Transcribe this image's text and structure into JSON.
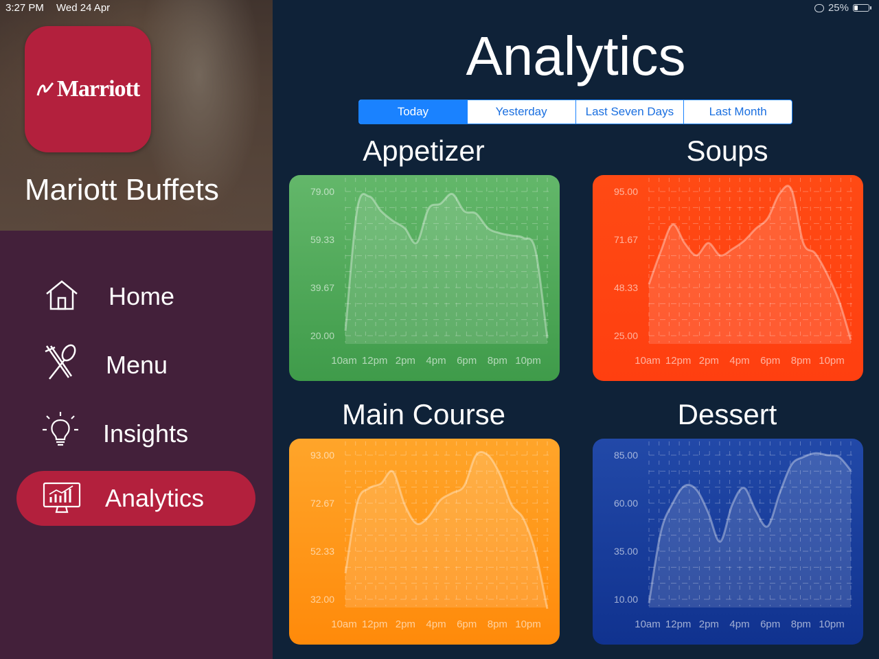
{
  "status": {
    "time": "3:27 PM",
    "date": "Wed 24 Apr",
    "battery": "25%",
    "battery_level": 0.25
  },
  "sidebar": {
    "logo_text": "Marriott",
    "app_title": "Mariott Buffets",
    "items": [
      {
        "label": "Home",
        "icon": "home-icon",
        "active": false
      },
      {
        "label": "Menu",
        "icon": "fork-spoon-icon",
        "active": false
      },
      {
        "label": "Insights",
        "icon": "lightbulb-icon",
        "active": false
      },
      {
        "label": "Analytics",
        "icon": "analytics-monitor-icon",
        "active": true
      }
    ]
  },
  "main": {
    "title": "Analytics",
    "tabs": [
      {
        "label": "Today",
        "active": true
      },
      {
        "label": "Yesterday",
        "active": false
      },
      {
        "label": "Last Seven Days",
        "active": false
      },
      {
        "label": "Last Month",
        "active": false
      }
    ]
  },
  "colors": {
    "accent": "#b3203d",
    "sidebar": "#43203a",
    "main_bg": "#0f2238",
    "segment_blue": "#1a82ff"
  },
  "chart_data": [
    {
      "type": "area",
      "title": "Appetizer",
      "color_top": "#63b76a",
      "color_bottom": "#3f9b4a",
      "x": [
        "10am",
        "12pm",
        "2pm",
        "4pm",
        "6pm",
        "8pm",
        "10pm"
      ],
      "y_ticks": [
        "79.00",
        "59.33",
        "39.67",
        "20.00"
      ],
      "ylim": [
        20,
        79
      ],
      "values": [
        22,
        72,
        77,
        71,
        67,
        64,
        58,
        72,
        74,
        78,
        71,
        70,
        64,
        62,
        61,
        60,
        55,
        19
      ]
    },
    {
      "type": "area",
      "title": "Soups",
      "color_top": "#ff4a14",
      "color_bottom": "#ff3f10",
      "x": [
        "10am",
        "12pm",
        "2pm",
        "4pm",
        "6pm",
        "8pm",
        "10pm"
      ],
      "y_ticks": [
        "95.00",
        "71.67",
        "48.33",
        "25.00"
      ],
      "ylim": [
        25,
        95
      ],
      "values": [
        50,
        66,
        79,
        70,
        64,
        70,
        64,
        67,
        71,
        77,
        82,
        94,
        96,
        70,
        65,
        55,
        42,
        23
      ]
    },
    {
      "type": "area",
      "title": "Main Course",
      "color_top": "#ffa52a",
      "color_bottom": "#ff8a0a",
      "x": [
        "10am",
        "12pm",
        "2pm",
        "4pm",
        "6pm",
        "8pm",
        "10pm"
      ],
      "y_ticks": [
        "93.00",
        "72.67",
        "52.33",
        "32.00"
      ],
      "ylim": [
        32,
        93
      ],
      "values": [
        43,
        73,
        79,
        81,
        86,
        72,
        64,
        67,
        74,
        77,
        80,
        93,
        93,
        85,
        72,
        66,
        52,
        28
      ]
    },
    {
      "type": "area",
      "title": "Dessert",
      "color_top": "#2249a8",
      "color_bottom": "#10328f",
      "x": [
        "10am",
        "12pm",
        "2pm",
        "4pm",
        "6pm",
        "8pm",
        "10pm"
      ],
      "y_ticks": [
        "85.00",
        "60.00",
        "35.00",
        "10.00"
      ],
      "ylim": [
        10,
        85
      ],
      "values": [
        8,
        45,
        60,
        69,
        67,
        55,
        40,
        59,
        68,
        56,
        48,
        65,
        80,
        84,
        86,
        85,
        84,
        77
      ]
    }
  ]
}
